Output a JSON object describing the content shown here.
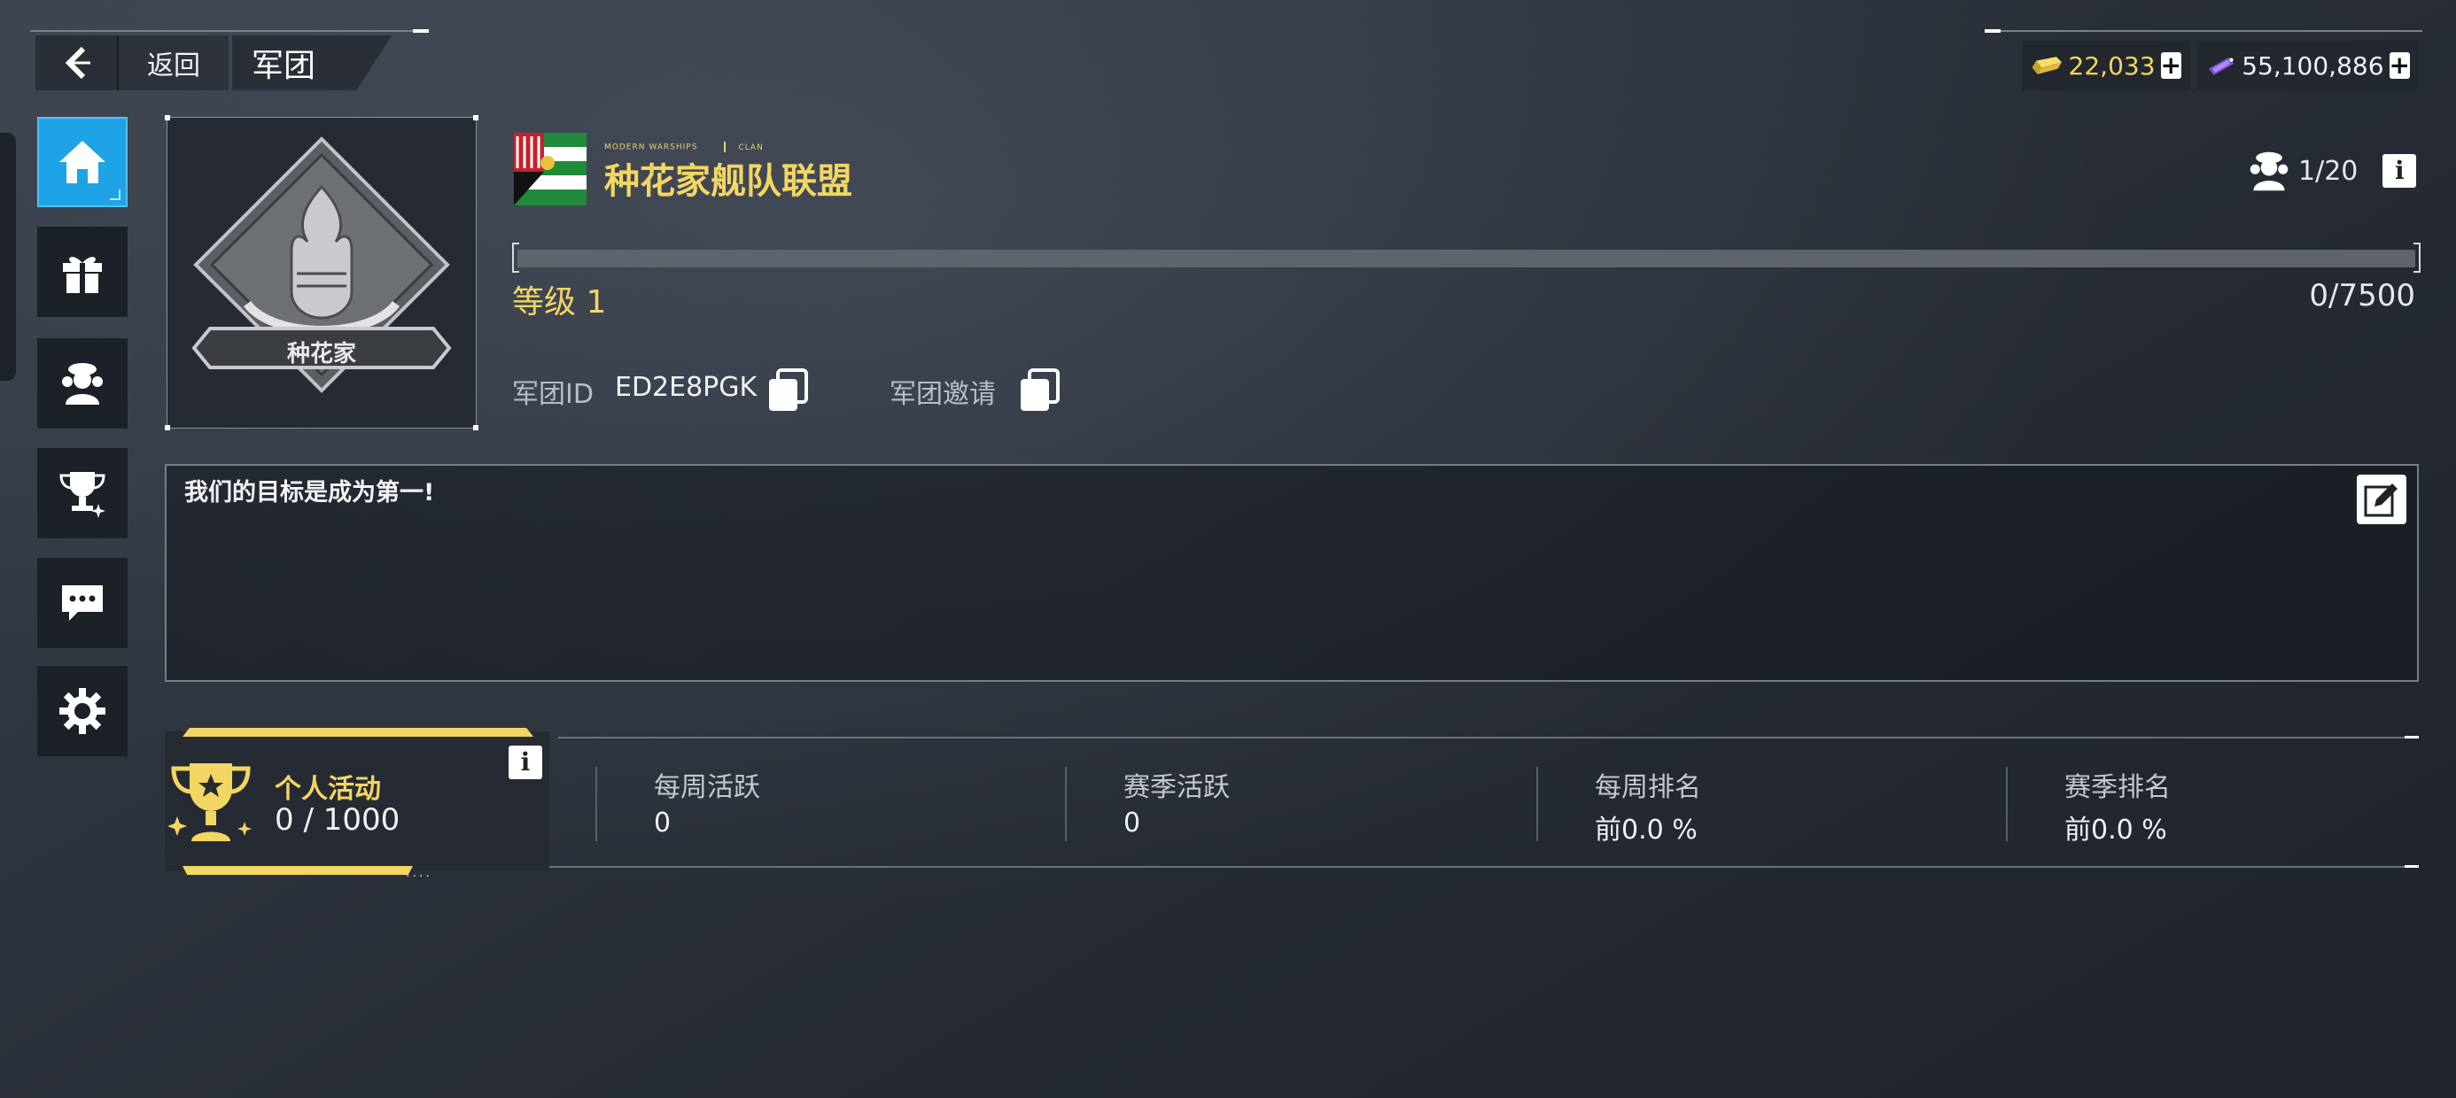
{
  "header": {
    "back_label": "返回",
    "title": "军团"
  },
  "resources": {
    "gold": "22,033",
    "gems": "55,100,886",
    "gold_color": "#f2d661"
  },
  "nav": {
    "items": [
      {
        "name": "home-icon",
        "active": true
      },
      {
        "name": "gift-icon",
        "active": false
      },
      {
        "name": "members-icon",
        "active": false
      },
      {
        "name": "trophy-icon",
        "active": false
      },
      {
        "name": "chat-icon",
        "active": false
      },
      {
        "name": "gear-icon",
        "active": false
      }
    ],
    "accent_color": "#1ea3e6"
  },
  "clan": {
    "emblem_tag": "种花家",
    "brand_left": "MODERN WARSHIPS",
    "brand_right": "CLAN",
    "name": "种花家舰队联盟",
    "members": "1/20",
    "level_label": "等级 1",
    "level_progress": 0.0,
    "xp": "0/7500",
    "id_label": "军团ID",
    "id_value": "ED2E8PGK",
    "invite_label": "军团邀请",
    "description": "我们的目标是成为第一!"
  },
  "activity": {
    "personal_label": "个人活动",
    "personal_value": "0 / 1000",
    "stats": [
      {
        "label": "每周活跃",
        "value": "0"
      },
      {
        "label": "赛季活跃",
        "value": "0"
      },
      {
        "label": "每周排名",
        "value": "前0.0 %"
      },
      {
        "label": "赛季排名",
        "value": "前0.0 %"
      }
    ]
  }
}
